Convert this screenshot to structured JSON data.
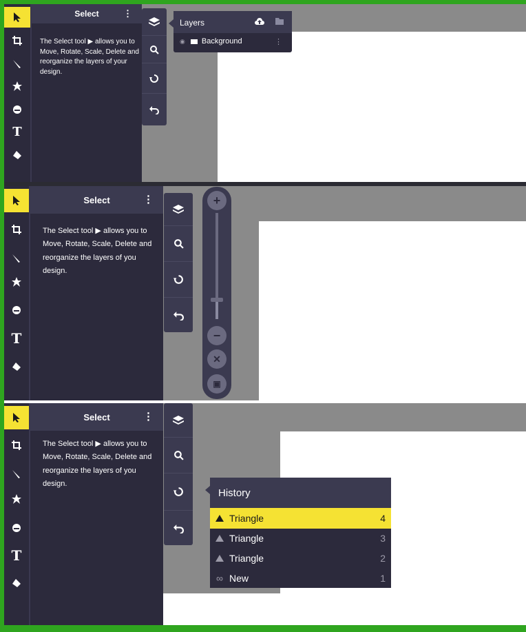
{
  "panels": [
    {
      "info": {
        "title": "Select",
        "text": "The Select tool ▶ allows you to Move, Rotate, Scale, Delete and reorganize the layers of your design."
      }
    },
    {
      "info": {
        "title": "Select",
        "text": "The Select tool ▶ allows you to Move, Rotate, Scale, Delete and reorganize the layers of you design."
      }
    },
    {
      "info": {
        "title": "Select",
        "text": "The Select tool ▶ allows you to Move, Rotate, Scale, Delete and reorganize the layers of you design."
      }
    }
  ],
  "layers": {
    "title": "Layers",
    "items": [
      {
        "name": "Background"
      }
    ]
  },
  "history": {
    "title": "History",
    "items": [
      {
        "label": "Triangle",
        "num": "4",
        "icon": "triangle-icon",
        "selected": true
      },
      {
        "label": "Triangle",
        "num": "3",
        "icon": "triangle-icon",
        "selected": false
      },
      {
        "label": "Triangle",
        "num": "2",
        "icon": "triangle-icon",
        "selected": false
      },
      {
        "label": "New",
        "num": "1",
        "icon": "infinity-icon",
        "selected": false
      }
    ]
  },
  "tools": [
    {
      "icon": "cursor-arrow-icon"
    },
    {
      "icon": "crop-icon"
    },
    {
      "icon": "brush-icon"
    },
    {
      "icon": "star-icon"
    },
    {
      "icon": "emoji-icon"
    },
    {
      "icon": "text-icon",
      "glyph": "T"
    },
    {
      "icon": "paint-bucket-icon"
    }
  ],
  "side_buttons": [
    {
      "icon": "layers-icon"
    },
    {
      "icon": "zoom-icon"
    },
    {
      "icon": "history-icon"
    },
    {
      "icon": "undo-icon"
    }
  ],
  "zoom_control": {
    "level": 0.18,
    "buttons": [
      "zoom-in-icon",
      "zoom-out-icon",
      "reset-zoom-icon",
      "fit-screen-icon"
    ]
  },
  "colors": {
    "frame": "#2fa51f",
    "accent": "#f5e233",
    "panel": "#2c2a3c",
    "header": "#3b3a50",
    "backdrop": "#8a8a8a"
  }
}
